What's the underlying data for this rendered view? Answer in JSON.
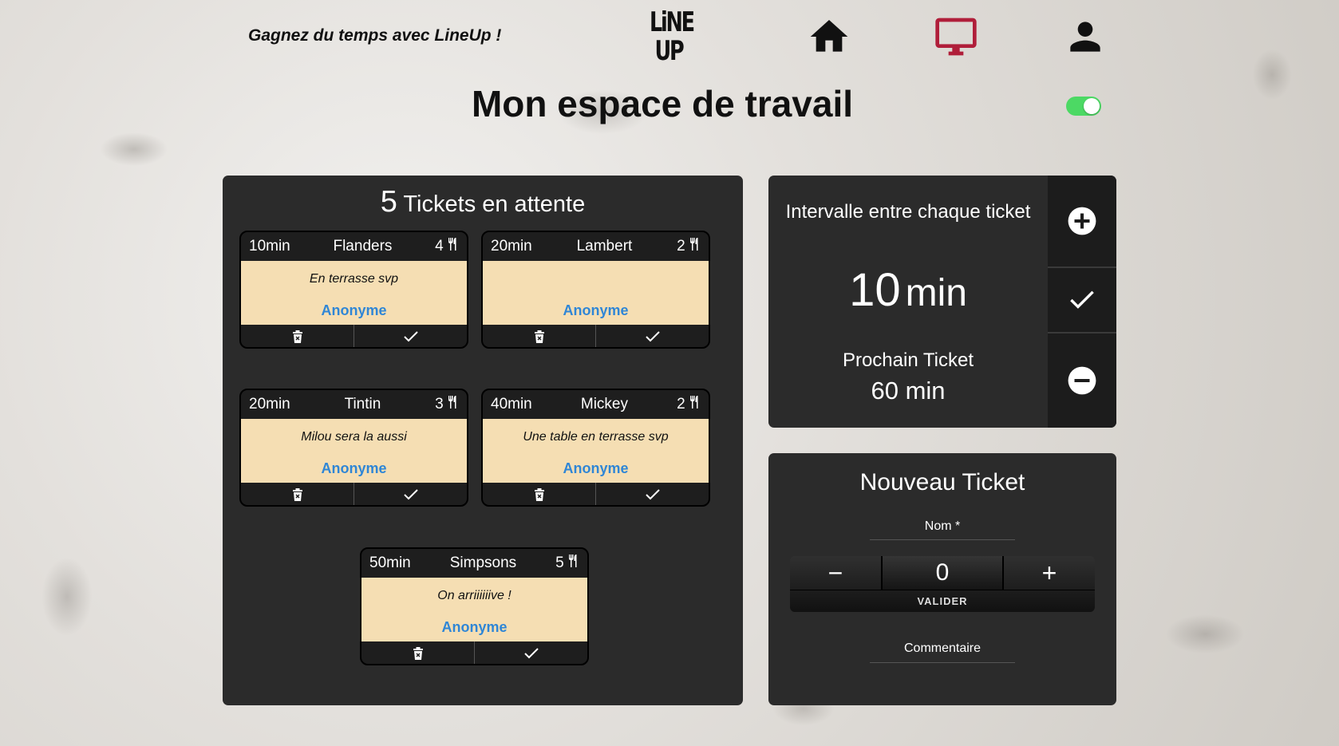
{
  "header": {
    "tagline": "Gagnez du temps avec LineUp !",
    "logo_line1": "LiNE",
    "logo_line2": "UP",
    "nav": [
      {
        "icon": "home-icon",
        "active": false
      },
      {
        "icon": "monitor-icon",
        "active": true,
        "color": "#b01e3a"
      },
      {
        "icon": "user-icon",
        "active": false
      }
    ]
  },
  "page": {
    "title": "Mon espace de travail",
    "toggle_on": true,
    "toggle_color": "#4cd964"
  },
  "queue": {
    "count": "5",
    "label": "Tickets en attente",
    "tickets": [
      {
        "wait": "10min",
        "name": "Flanders",
        "guests": "4",
        "comment": "En terrasse svp",
        "user": "Anonyme"
      },
      {
        "wait": "20min",
        "name": "Lambert",
        "guests": "2",
        "comment": "",
        "user": "Anonyme"
      },
      {
        "wait": "20min",
        "name": "Tintin",
        "guests": "3",
        "comment": "Milou sera la aussi",
        "user": "Anonyme"
      },
      {
        "wait": "40min",
        "name": "Mickey",
        "guests": "2",
        "comment": "Une table en terrasse svp",
        "user": "Anonyme"
      },
      {
        "wait": "50min",
        "name": "Simpsons",
        "guests": "5",
        "comment": "On arriiiiiive !",
        "user": "Anonyme"
      }
    ]
  },
  "interval": {
    "label": "Intervalle entre chaque ticket",
    "value": "10",
    "unit": "min",
    "next_label": "Prochain Ticket",
    "next_value": "60 min"
  },
  "new_ticket": {
    "title": "Nouveau Ticket",
    "name_label": "Nom *",
    "stepper_minus": "−",
    "stepper_value": "0",
    "stepper_plus": "+",
    "submit_label": "VALIDER",
    "comment_label": "Commentaire"
  },
  "colors": {
    "panel": "#2b2b2b",
    "ticket_body": "#f5deb3",
    "user_link": "#2f86d6"
  }
}
